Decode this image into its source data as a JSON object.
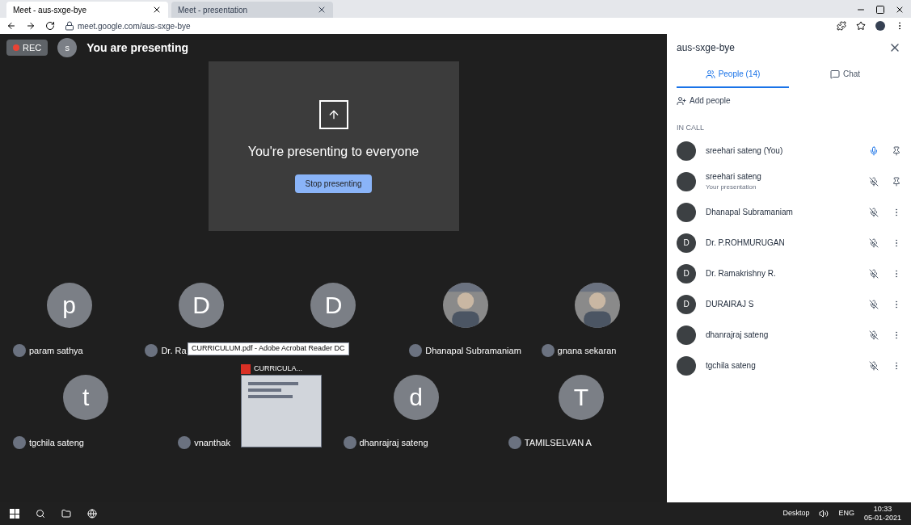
{
  "browser": {
    "tabs": [
      {
        "title": "Meet - aus-sxge-bye",
        "selected": true
      },
      {
        "title": "Meet - presentation",
        "selected": false
      }
    ],
    "url": "meet.google.com/aus-sxge-bye"
  },
  "meeting": {
    "rec": "REC",
    "avatar": "s",
    "banner": "You are presenting",
    "presenting_text": "You're presenting to everyone",
    "stop_button": "Stop presenting"
  },
  "tiles": [
    {
      "initial": "p",
      "name": "param sathya",
      "kind": "letter"
    },
    {
      "initial": "D",
      "name": "Dr. Ra",
      "kind": "letter"
    },
    {
      "initial": "D",
      "kind": "letter"
    },
    {
      "name": "Dhanapal Subramaniam"
    },
    {
      "name": "gnana sekaran"
    },
    {
      "initial": "t",
      "name": "tgchila sateng",
      "kind": "letter"
    },
    {
      "name": "vnanthak",
      "kind": "hidden"
    },
    {
      "initial": "d",
      "name": "dhanrajraj sateng",
      "kind": "letter"
    },
    {
      "initial": "T",
      "name": "TAMILSELVAN A",
      "kind": "letter"
    }
  ],
  "tooltip": "CURRICULUM.pdf - Adobe Acrobat Reader DC",
  "thumbnail_title": "CURRICULA...",
  "panel": {
    "title": "aus-sxge-bye",
    "tabs": [
      {
        "label": "People (14)",
        "selected": true
      },
      {
        "label": "Chat",
        "selected": false
      }
    ],
    "add_people": "Add people",
    "section": "IN CALL",
    "people": [
      {
        "name": "sreehari sateng (You)",
        "muted": false
      },
      {
        "name": "sreehari sateng",
        "subtitle": "Your presentation",
        "muted": true
      },
      {
        "name": "Dhanapal Subramaniam",
        "muted": true
      },
      {
        "name": "Dr. P.ROHMURUGAN",
        "initial": "D",
        "muted": true
      },
      {
        "name": "Dr. Ramakrishny R.",
        "initial": "D",
        "muted": true
      },
      {
        "name": "DURAIRAJ S",
        "initial": "D",
        "muted": true
      },
      {
        "name": "dhanrajraj sateng",
        "muted": true
      },
      {
        "name": "tgchila sateng",
        "muted": true
      }
    ]
  },
  "taskbar": {
    "desktop": "Desktop",
    "lang": "ENG",
    "time": "10:33",
    "date": "05-01-2021"
  }
}
